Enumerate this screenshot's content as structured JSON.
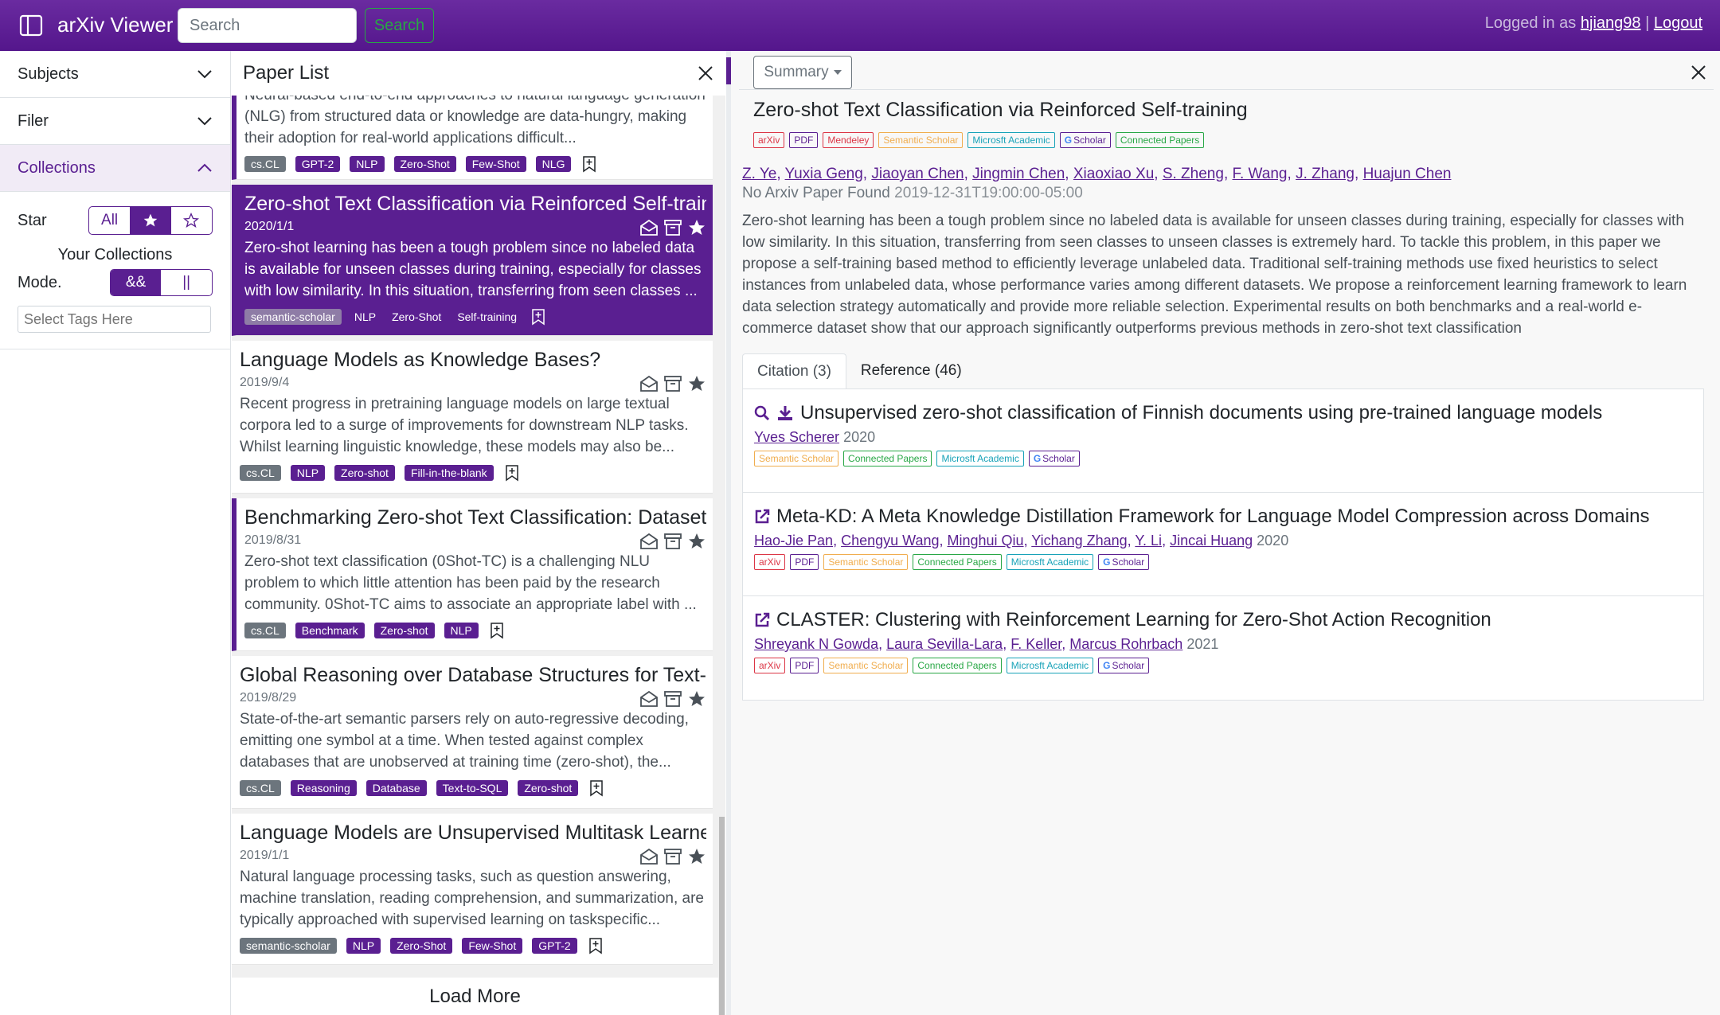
{
  "app": {
    "title": "arXiv Viewer"
  },
  "search": {
    "placeholder": "Search",
    "button": "Search"
  },
  "login": {
    "prefix": "Logged in as",
    "user": "hjiang98",
    "sep": "|",
    "logout": "Logout"
  },
  "sidebar": {
    "sections": [
      "Subjects",
      "Filer",
      "Collections"
    ],
    "star_label": "Star",
    "star_options": [
      "All"
    ],
    "collections_title": "Your Collections",
    "mode_label": "Mode.",
    "mode_options": [
      "&&",
      "||"
    ],
    "tag_placeholder": "Select Tags Here"
  },
  "paper_list": {
    "title": "Paper List",
    "load_more": "Load More",
    "papers": [
      {
        "title": "",
        "date": "",
        "abstract": "Neural-based end-to-end approaches to natural language generation (NLG) from structured data or knowledge are data-hungry, making their adoption for real-world applications difficult...",
        "tags": [
          "cs.CL",
          "GPT-2",
          "NLP",
          "Zero-Shot",
          "Few-Shot",
          "NLG"
        ]
      },
      {
        "title": "Zero-shot Text Classification via Reinforced Self-training",
        "date": "2020/1/1",
        "abstract": "Zero-shot learning has been a tough problem since no labeled data is available for unseen classes during training, especially for classes with low similarity. In this situation, transferring from seen classes ...",
        "tags": [
          "semantic-scholar",
          "NLP",
          "Zero-Shot",
          "Self-training"
        ]
      },
      {
        "title": "Language Models as Knowledge Bases?",
        "date": "2019/9/4",
        "abstract": "Recent progress in pretraining language models on large textual corpora led to a surge of improvements for downstream NLP tasks. Whilst learning linguistic knowledge, these models may also be...",
        "tags": [
          "cs.CL",
          "NLP",
          "Zero-shot",
          "Fill-in-the-blank"
        ]
      },
      {
        "title": "Benchmarking Zero-shot Text Classification: Datasets, E",
        "date": "2019/8/31",
        "abstract": "Zero-shot text classification (0Shot-TC) is a challenging NLU problem to which little attention has been paid by the research community. 0Shot-TC aims to associate an appropriate label with ...",
        "tags": [
          "cs.CL",
          "Benchmark",
          "Zero-shot",
          "NLP"
        ]
      },
      {
        "title": "Global Reasoning over Database Structures for Text-to",
        "date": "2019/8/29",
        "abstract": "State-of-the-art semantic parsers rely on auto-regressive decoding, emitting one symbol at a time. When tested against complex databases that are unobserved at training time (zero-shot), the...",
        "tags": [
          "cs.CL",
          "Reasoning",
          "Database",
          "Text-to-SQL",
          "Zero-shot"
        ]
      },
      {
        "title": "Language Models are Unsupervised Multitask Learners",
        "date": "2019/1/1",
        "abstract": "Natural language processing tasks, such as question answering, machine translation, reading comprehension, and summarization, are typically approached with supervised learning on taskspecific...",
        "tags": [
          "semantic-scholar",
          "NLP",
          "Zero-Shot",
          "Few-Shot",
          "GPT-2"
        ]
      }
    ]
  },
  "detail": {
    "view": "Summary",
    "title": "Zero-shot Text Classification via Reinforced Self-training",
    "links": [
      "arXiv",
      "PDF",
      "Mendeley",
      "Semantic Scholar",
      "Microsft Academic",
      "Scholar",
      "Connected Papers"
    ],
    "authors": [
      "Z. Ye",
      "Yuxia Geng",
      "Jiaoyan Chen",
      "Jingmin Chen",
      "Xiaoxiao Xu",
      "S. Zheng",
      "F. Wang",
      "J. Zhang",
      "Huajun Chen"
    ],
    "no_arxiv": "No Arxiv Paper Found",
    "timestamp": "2019-12-31T19:00:00-05:00",
    "abstract": "Zero-shot learning has been a tough problem since no labeled data is available for unseen classes during training, especially for classes with low similarity. In this situation, transferring from seen classes to unseen classes is extremely hard. To tackle this problem, in this paper we propose a self-training based method to efficiently leverage unlabeled data. Traditional self-training methods use fixed heuristics to select instances from unlabeled data, whose performance varies among different datasets. We propose a reinforcement learning framework to learn data selection strategy automatically and provide more reliable selection. Experimental results on both benchmarks and a real-world e-commerce dataset show that our approach significantly outperforms previous methods in zero-shot text classification",
    "tabs": [
      "Citation (3)",
      "Reference (46)"
    ],
    "refs": [
      {
        "title": "Unsupervised zero-shot classification of Finnish documents using pre-trained language models",
        "authors": [
          "Yves Scherer"
        ],
        "year": "2020",
        "links": [
          "Semantic Scholar",
          "Connected Papers",
          "Microsft Academic",
          "Scholar"
        ]
      },
      {
        "title": "Meta-KD: A Meta Knowledge Distillation Framework for Language Model Compression across Domains",
        "authors": [
          "Hao-Jie Pan",
          "Chengyu Wang",
          "Minghui Qiu",
          "Yichang Zhang",
          "Y. Li",
          "Jincai Huang"
        ],
        "year": "2020",
        "links": [
          "arXiv",
          "PDF",
          "Semantic Scholar",
          "Connected Papers",
          "Microsft Academic",
          "Scholar"
        ]
      },
      {
        "title": "CLASTER: Clustering with Reinforcement Learning for Zero-Shot Action Recognition",
        "authors": [
          "Shreyank N Gowda",
          "Laura Sevilla-Lara",
          "F. Keller",
          "Marcus Rohrbach"
        ],
        "year": "2021",
        "links": [
          "arXiv",
          "PDF",
          "Semantic Scholar",
          "Connected Papers",
          "Microsft Academic",
          "Scholar"
        ]
      }
    ]
  },
  "colors": {
    "brand": "#5a1f91",
    "topbar": "#6a2ba0",
    "success": "#28a745"
  }
}
